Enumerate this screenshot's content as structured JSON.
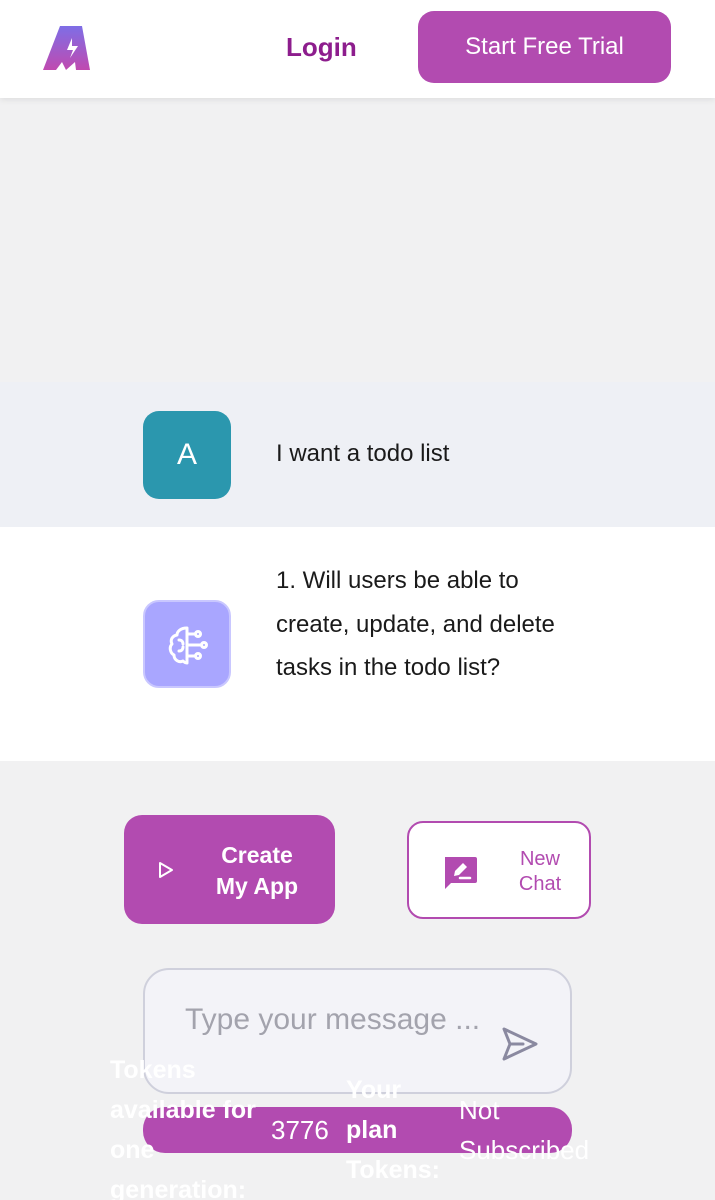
{
  "header": {
    "login_label": "Login",
    "trial_label": "Start Free Trial"
  },
  "colors": {
    "brand": "#b24bb0",
    "login_text": "#8d1d8d",
    "user_avatar": "#2b97ae",
    "bot_avatar": "#a9a6ff"
  },
  "chat": {
    "user": {
      "avatar_letter": "A",
      "message": "I want a todo list"
    },
    "bot": {
      "avatar_icon": "brain-circuit-icon",
      "message": "1. Will users be able to create, update, and delete tasks in the todo list?"
    }
  },
  "actions": {
    "create_label": "Create My App",
    "new_chat_label": "New Chat"
  },
  "composer": {
    "placeholder": "Type your message ..."
  },
  "tokens": {
    "available_label": "Tokens available for one generation:",
    "available_value": "3776",
    "plan_label": "Your plan Tokens:",
    "plan_value": "Not Subscribed"
  }
}
